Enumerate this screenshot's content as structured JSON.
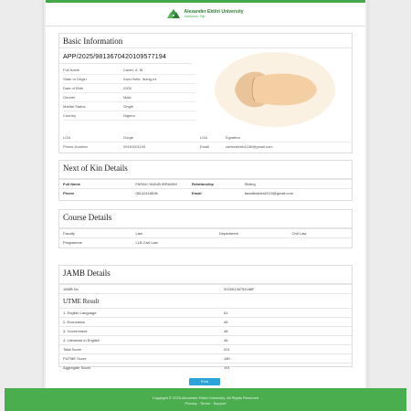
{
  "header": {
    "university": "Alexander Ekitiri University",
    "subtitle": "Admission Slip"
  },
  "basic": {
    "title": "Basic Information",
    "application_no": "APP/2025/9813670420109577194",
    "left_fields": [
      {
        "label": "Full Name",
        "value": "Carter, A. M."
      },
      {
        "label": "State of Origin",
        "value": "Kwa-Hotte, Ibang-ez"
      },
      {
        "label": "Date of Birth",
        "value": "2005"
      },
      {
        "label": "Gender",
        "value": "Male"
      },
      {
        "label": "Marital Status",
        "value": "Single"
      },
      {
        "label": "Country",
        "value": "Nigeria"
      }
    ],
    "bottom_fields": [
      {
        "label": "LGA",
        "value": "Gorge"
      },
      {
        "label": "Phone Number",
        "value": "09181001100"
      },
      {
        "label": "LGA",
        "value": "Egnatinn"
      },
      {
        "label": "Email",
        "value": "carterakhiln1156@gmail.com"
      }
    ]
  },
  "kin": {
    "title": "Next of Kin Details",
    "rows": [
      {
        "l1": "Full Name",
        "v1": "FARAH YAKUB IBRAHIM",
        "l2": "Relationship",
        "v2": "Sibling"
      },
      {
        "l1": "Phone",
        "v1": "08142418836",
        "l2": "Email",
        "v2": "faradibrahim2015@gmail.com"
      }
    ]
  },
  "course": {
    "title": "Course Details",
    "rows": [
      {
        "l1": "Faculty",
        "v1": "Law",
        "l2": "Department",
        "v2": "Civil Law"
      },
      {
        "l1": "Programme",
        "v1": "LLB Civil Law",
        "l2": "",
        "v2": ""
      }
    ]
  },
  "jamb": {
    "title": "JAMB Details",
    "reg_label": "JAMB No",
    "reg_value": "20255136754186F",
    "utme_title": "UTME Result",
    "scores": [
      {
        "label": "1. English Language",
        "value": "61"
      },
      {
        "label": "2. Economics",
        "value": "46"
      },
      {
        "label": "3. Government",
        "value": "48"
      },
      {
        "label": "4. Literature in English",
        "value": "46"
      },
      {
        "label": "Total Score",
        "value": "201"
      },
      {
        "label": "PUTME Score",
        "value": "180"
      },
      {
        "label": "Aggregate Score",
        "value": "191"
      }
    ]
  },
  "print_label": "Print",
  "footer": {
    "line1": "Copyright © 2025 Alexander Ekitiri University. All Rights Reserved",
    "line2": "Privacy · Terms · Support"
  }
}
